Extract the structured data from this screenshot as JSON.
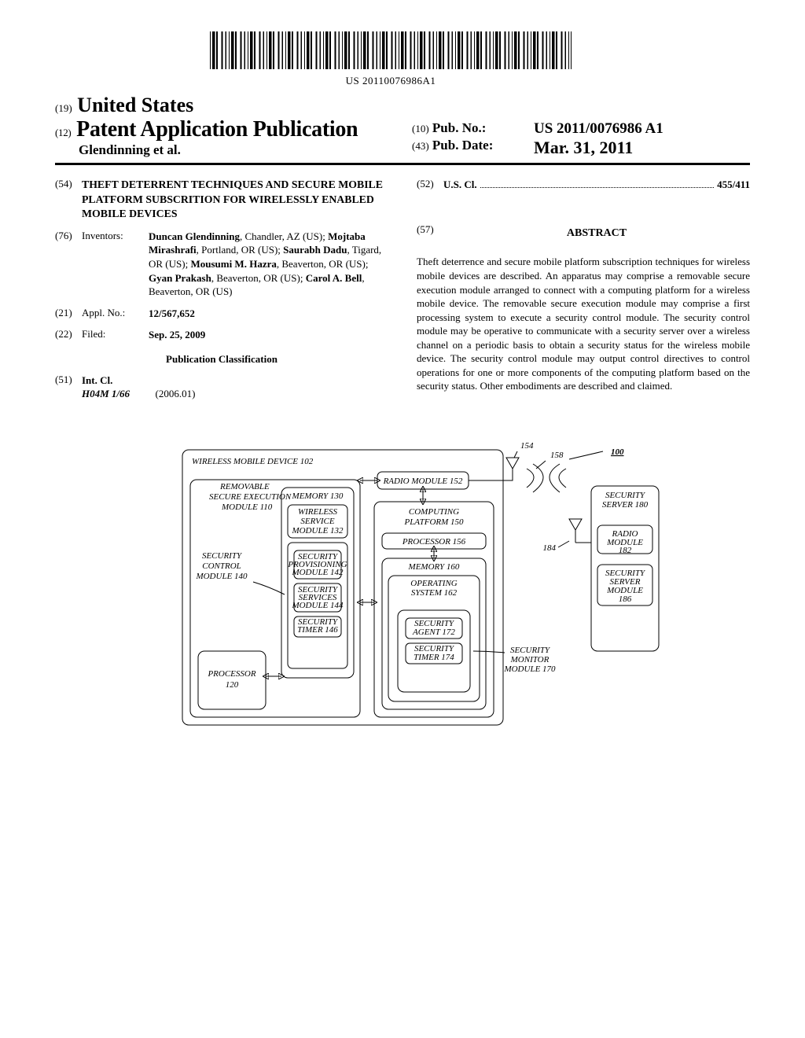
{
  "barcodeNumber": "US 20110076986A1",
  "header": {
    "countryTag": "(19)",
    "country": "United States",
    "pubTag": "(12)",
    "pubType": "Patent Application Publication",
    "authorsLine": "Glendinning et al.",
    "pubNoTag": "(10)",
    "pubNoLabel": "Pub. No.:",
    "pubNo": "US 2011/0076986 A1",
    "pubDateTag": "(43)",
    "pubDateLabel": "Pub. Date:",
    "pubDate": "Mar. 31, 2011"
  },
  "left": {
    "titleTag": "(54)",
    "title": "THEFT DETERRENT TECHNIQUES AND SECURE MOBILE PLATFORM SUBSCRITION FOR WIRELESSLY ENABLED MOBILE DEVICES",
    "inventorsTag": "(76)",
    "inventorsLabel": "Inventors:",
    "inventors": "Duncan Glendinning, Chandler, AZ (US); Mojtaba Mirashrafi, Portland, OR (US); Saurabh Dadu, Tigard, OR (US); Mousumi M. Hazra, Beaverton, OR (US); Gyan Prakash, Beaverton, OR (US); Carol A. Bell, Beaverton, OR (US)",
    "applTag": "(21)",
    "applLabel": "Appl. No.:",
    "applNo": "12/567,652",
    "filedTag": "(22)",
    "filedLabel": "Filed:",
    "filedDate": "Sep. 25, 2009",
    "pubClass": "Publication Classification",
    "intClTag": "(51)",
    "intClLabel": "Int. Cl.",
    "intClCode": "H04M 1/66",
    "intClVersion": "(2006.01)"
  },
  "right": {
    "usClTag": "(52)",
    "usClLabel": "U.S. Cl.",
    "usClCode": "455/411",
    "abstractTag": "(57)",
    "abstractLabel": "ABSTRACT",
    "abstract": "Theft deterrence and secure mobile platform subscription techniques for wireless mobile devices are described. An apparatus may comprise a removable secure execution module arranged to connect with a computing platform for a wireless mobile device. The removable secure execution module may comprise a first processing system to execute a security control module. The security control module may be operative to communicate with a security server over a wireless channel on a periodic basis to obtain a security status for the wireless mobile device. The security control module may output control directives to control operations for one or more components of the computing platform based on the security status. Other embodiments are described and claimed."
  },
  "fig": {
    "ref100": "100",
    "deviceTitle": "WIRELESS MOBILE DEVICE 102",
    "removable": "REMOVABLE SECURE EXECUTION MODULE 110",
    "memory130": "MEMORY 130",
    "wsm132": "WIRELESS SERVICE MODULE 132",
    "scm140": "SECURITY CONTROL MODULE 140",
    "spm142": "SECURITY PROVISIONING MODULE 142",
    "ssm144": "SECURITY SERVICES MODULE 144",
    "st146": "SECURITY TIMER 146",
    "proc120": "PROCESSOR 120",
    "radio152": "RADIO MODULE 152",
    "cp150": "COMPUTING PLATFORM 150",
    "proc156": "PROCESSOR 156",
    "mem160": "MEMORY 160",
    "os162": "OPERATING SYSTEM 162",
    "sa172": "SECURITY AGENT 172",
    "st174": "SECURITY TIMER 174",
    "smm170": "SECURITY MONITOR MODULE 170",
    "ss180": "SECURITY SERVER 180",
    "rm182": "RADIO MODULE 182",
    "ssm186": "SECURITY SERVER MODULE 186",
    "l154": "154",
    "l158": "158",
    "l184": "184"
  }
}
